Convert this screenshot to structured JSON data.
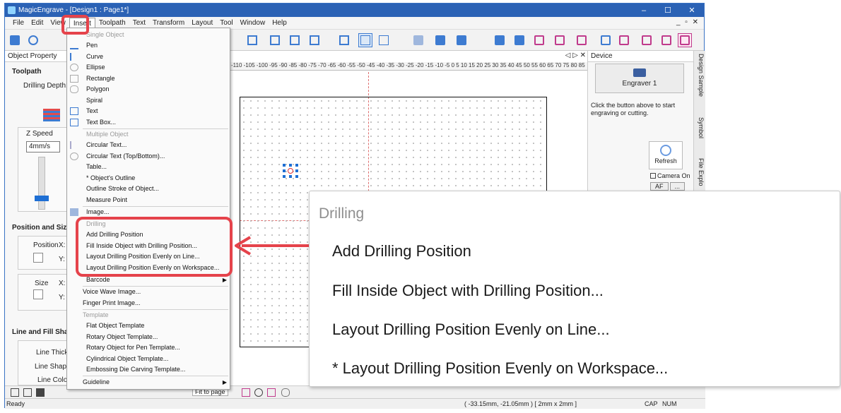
{
  "window": {
    "title": "MagicEngrave - [Design1 : Page1*]",
    "controls": [
      "–",
      "☐",
      "✕"
    ]
  },
  "menubar": {
    "items": [
      "File",
      "Edit",
      "View",
      "Insert",
      "Toolpath",
      "Text",
      "Transform",
      "Layout",
      "Tool",
      "Window",
      "Help"
    ],
    "mdi_controls": "_ ▫ ✕"
  },
  "left_panel": {
    "header": "Object Property",
    "toolpath_title": "Toolpath",
    "drilling_depth_label": "Drilling Depth:",
    "z_speed_label": "Z Speed",
    "z_speed_value": "4mm/s",
    "position_size_title": "Position and Size",
    "position_label": "Position",
    "x_label": "X:",
    "y_label": "Y:",
    "size_label": "Size",
    "line_fill_title": "Line and Fill Shape",
    "line_thick_label": "Line Thick:",
    "line_shape_label": "Line Shape:",
    "line_color_label": "Line Color:"
  },
  "canvas": {
    "ruler_text": "-110 -105 -100 -95 -90 -85 -80 -75 -70 -65 -60 -55 -50 -45 -40 -35 -30 -25 -20 -15 -10 -5 0 5 10 15 20 25 30 35 40 45 50 55 60 65 70 75 80 85",
    "tab_controls": "◁ ▷ ✕"
  },
  "right_panel": {
    "header": "Device",
    "engraver_label": "Engraver 1",
    "note": "Click the button above to start engraving or cutting.",
    "refresh_label": "Refresh",
    "camera_label": "Camera On",
    "af_label": "AF",
    "more_label": "..."
  },
  "side_tabs": [
    "Design Sample",
    "Symbol",
    "File Explo"
  ],
  "bottom_tools": {
    "zoom_option": "Fit to page"
  },
  "statusbar": {
    "left": "Ready",
    "coords": "( -33.15mm, -21.05mm )  [ 2mm x 2mm ]",
    "cap": "CAP",
    "num": "NUM"
  },
  "insert_menu": {
    "single_header": "Single Object",
    "single_items": [
      "Pen",
      "Curve",
      "Ellipse",
      "Rectangle",
      "Polygon",
      "Spiral",
      "Text",
      "Text Box..."
    ],
    "multiple_header": "Multiple Object",
    "multiple_items": [
      "Circular Text...",
      "Circular Text (Top/Bottom)...",
      "Table...",
      "* Object's Outline",
      "Outline Stroke of Object...",
      "Measure Point"
    ],
    "image_item": "Image...",
    "drilling_header": "Drilling",
    "drilling_items": [
      "Add Drilling Position",
      "Fill Inside Object with Drilling Position...",
      "Layout Drilling Position Evenly on Line...",
      "Layout Drilling Position Evenly on Workspace..."
    ],
    "barcode_item": "Barcode",
    "voice_item": "Voice Wave Image...",
    "finger_item": "Finger Print Image...",
    "template_header": "Template",
    "template_items": [
      "Flat Object Template",
      "Rotary Object Template...",
      "Rotary Object for Pen Template...",
      "Cylindrical Object Template...",
      "Embossing Die Carving Template..."
    ],
    "guideline_item": "Guideline"
  },
  "zoom_callout": {
    "header": "Drilling",
    "items": [
      "Add Drilling Position",
      "Fill Inside Object with Drilling Position...",
      "Layout Drilling Position Evenly on Line...",
      "* Layout Drilling Position Evenly on Workspace..."
    ]
  },
  "colors": {
    "highlight": "#e5434b",
    "titlebar": "#2b62b5",
    "accent": "#1e6fd4"
  }
}
